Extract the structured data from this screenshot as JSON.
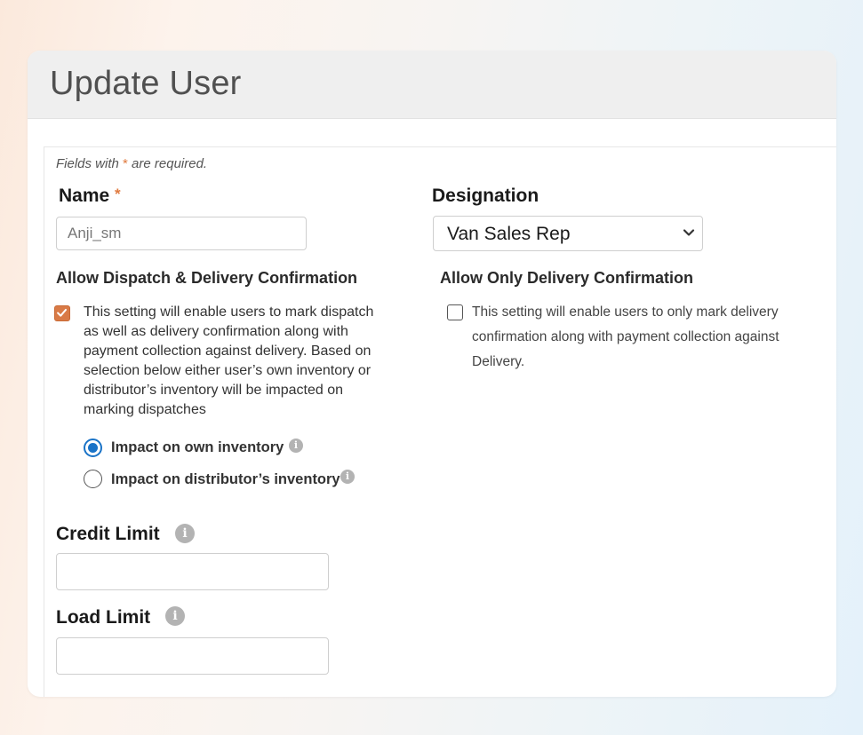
{
  "page": {
    "title": "Update User",
    "required_note_prefix": "Fields with ",
    "required_marker": "*",
    "required_note_suffix": " are required."
  },
  "form": {
    "name": {
      "label": "Name",
      "required_marker": "*",
      "value": "Anji_sm"
    },
    "designation": {
      "label": "Designation",
      "selected": "Van Sales Rep"
    },
    "dispatch_delivery": {
      "label": "Allow Dispatch & Delivery Confirmation",
      "checked": true,
      "description_lines": [
        "This setting will enable users to mark dispatch",
        "as well as delivery confirmation along with",
        "payment collection against delivery. Based on",
        "selection below either user’s own inventory or",
        "distributor’s inventory will be impacted on",
        "marking dispatches"
      ],
      "inventory_options": [
        {
          "label": "Impact on own inventory",
          "selected": true
        },
        {
          "label": "Impact on distributor’s inventory",
          "selected": false
        }
      ]
    },
    "delivery_only": {
      "label": "Allow Only Delivery Confirmation",
      "checked": false,
      "description_lines": [
        "This setting will enable users to only mark delivery",
        "confirmation along with payment collection against",
        "Delivery."
      ]
    },
    "credit_limit": {
      "label": "Credit Limit",
      "value": ""
    },
    "load_limit": {
      "label": "Load Limit",
      "value": ""
    }
  },
  "icons": {
    "info": "info-icon",
    "chevron": "chevron-down-icon",
    "check": "checkmark-icon"
  },
  "colors": {
    "accent_orange": "#d97a46",
    "radio_blue": "#1a73c7",
    "header_bg": "#efefef"
  }
}
